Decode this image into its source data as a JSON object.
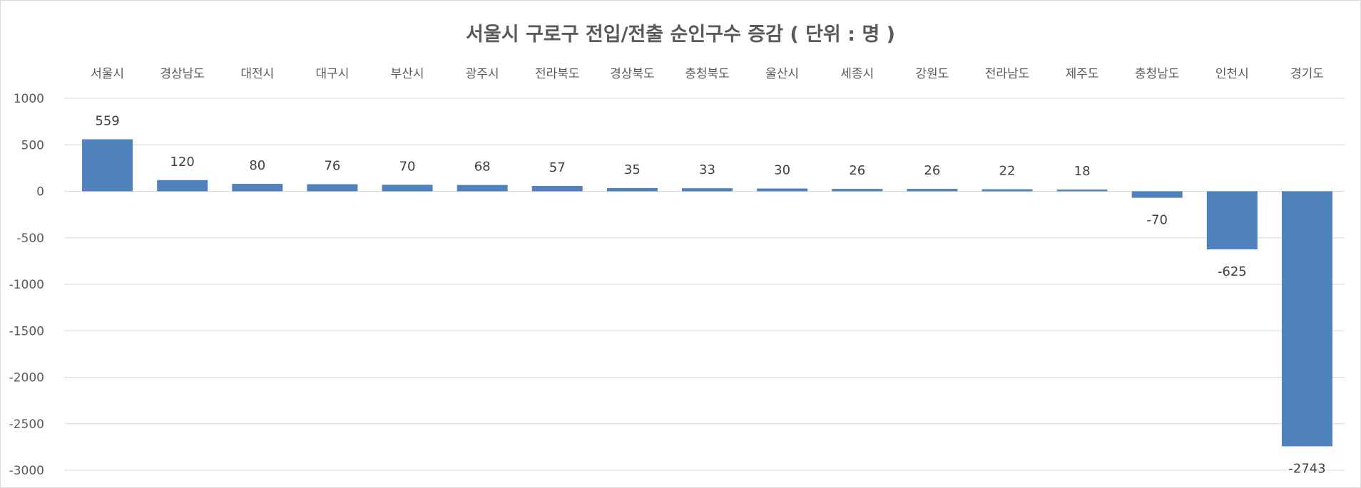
{
  "chart_data": {
    "type": "bar",
    "title": "서울시 구로구 전입/전출 순인구수 증감 ( 단위 : 명 )",
    "xlabel": "",
    "ylabel": "",
    "categories": [
      "서울시",
      "경상남도",
      "대전시",
      "대구시",
      "부산시",
      "광주시",
      "전라북도",
      "경상북도",
      "충청북도",
      "울산시",
      "세종시",
      "강원도",
      "전라남도",
      "제주도",
      "충청남도",
      "인천시",
      "경기도"
    ],
    "values": [
      559,
      120,
      80,
      76,
      70,
      68,
      57,
      35,
      33,
      30,
      26,
      26,
      22,
      18,
      -70,
      -625,
      -2743
    ],
    "ylim": [
      -3000,
      1000
    ],
    "yticks": [
      1000,
      500,
      0,
      -500,
      -1000,
      -1500,
      -2000,
      -2500,
      -3000
    ],
    "category_labels_position": "top",
    "data_labels": true,
    "grid": true,
    "legend": "none",
    "colors": {
      "bar": "#4f81bd",
      "grid": "#d9d9d9",
      "text": "#595959",
      "label": "#404040"
    }
  }
}
